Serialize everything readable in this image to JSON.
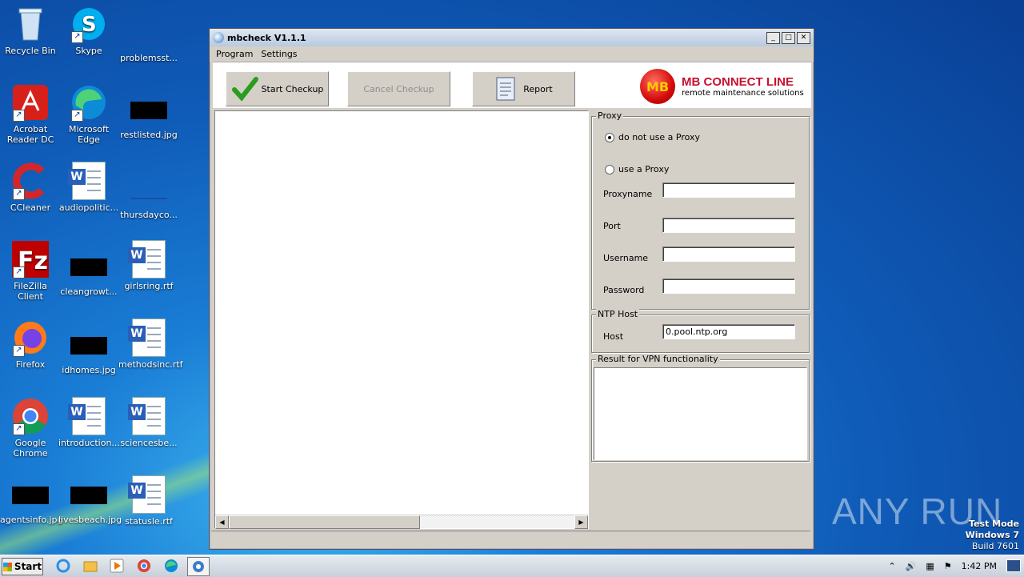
{
  "desktop": {
    "icons": [
      {
        "label": "Recycle Bin",
        "icon": "recycle-bin-icon"
      },
      {
        "label": "Skype",
        "icon": "skype-icon"
      },
      {
        "label": "problemsst...",
        "icon": "image-file-icon"
      },
      {
        "label": "Acrobat Reader DC",
        "icon": "acrobat-icon"
      },
      {
        "label": "Microsoft Edge",
        "icon": "edge-icon"
      },
      {
        "label": "restlisted.jpg",
        "icon": "image-file-icon"
      },
      {
        "label": "CCleaner",
        "icon": "ccleaner-icon"
      },
      {
        "label": "audiopolitic...",
        "icon": "word-doc-icon"
      },
      {
        "label": "thursdayco...",
        "icon": "image-file-icon"
      },
      {
        "label": "FileZilla Client",
        "icon": "filezilla-icon"
      },
      {
        "label": "cleangrowt...",
        "icon": "image-file-icon"
      },
      {
        "label": "girlsring.rtf",
        "icon": "word-doc-icon"
      },
      {
        "label": "Firefox",
        "icon": "firefox-icon"
      },
      {
        "label": "idhomes.jpg",
        "icon": "image-file-icon"
      },
      {
        "label": "methodsinc.rtf",
        "icon": "word-doc-icon"
      },
      {
        "label": "Google Chrome",
        "icon": "chrome-icon"
      },
      {
        "label": "introduction...",
        "icon": "word-doc-icon"
      },
      {
        "label": "sciencesbe...",
        "icon": "word-doc-icon"
      },
      {
        "label": "agentsinfo.jpg",
        "icon": "image-file-icon"
      },
      {
        "label": "livesbeach.jpg",
        "icon": "image-file-icon"
      },
      {
        "label": "statusle.rtf",
        "icon": "word-doc-icon"
      }
    ]
  },
  "window": {
    "title": "mbcheck V1.1.1",
    "menu": [
      "Program",
      "Settings"
    ],
    "toolbar": {
      "start_label": "Start Checkup",
      "cancel_label": "Cancel Checkup",
      "report_label": "Report"
    },
    "logo": {
      "badge": "MB",
      "line1": "MB CONNECT LINE",
      "line2": "remote maintenance solutions"
    },
    "proxy": {
      "group_title": "Proxy",
      "option_none": "do not use a Proxy",
      "option_use": "use a Proxy",
      "selected": "do not use a Proxy",
      "proxyname_label": "Proxyname",
      "proxyname_value": "",
      "port_label": "Port",
      "port_value": "",
      "username_label": "Username",
      "username_value": "",
      "password_label": "Password",
      "password_value": ""
    },
    "ntp": {
      "group_title": "NTP Host",
      "host_label": "Host",
      "host_value": "0.pool.ntp.org"
    },
    "vpn": {
      "group_title": "Result for VPN functionality"
    }
  },
  "watermark": {
    "brand": "ANY RUN",
    "line1": "Test Mode",
    "line2": "Windows 7",
    "line3": "Build 7601"
  },
  "taskbar": {
    "start_label": "Start",
    "clock": "1:42 PM"
  }
}
